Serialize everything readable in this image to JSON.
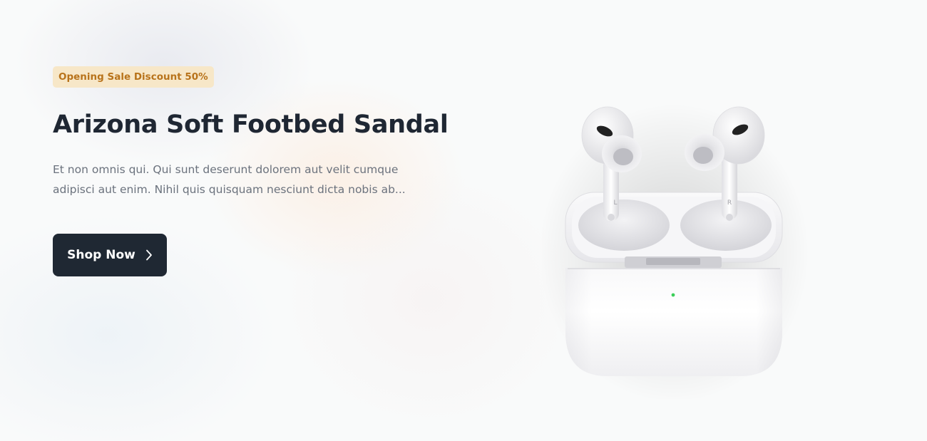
{
  "hero": {
    "badge": "Opening Sale Discount 50%",
    "title": "Arizona Soft Footbed Sandal",
    "description": "Et non omnis qui. Qui sunt deserunt dolorem aut velit cumque adipisci aut enim. Nihil quis quisquam nesciunt dicta nobis ab...",
    "button_label": "Shop Now",
    "button_icon": "chevron-right-icon"
  },
  "product_image": {
    "left_bud_mark": "L",
    "right_bud_mark": "R"
  },
  "colors": {
    "badge_bg": "#f7e7c8",
    "badge_text": "#b8731b",
    "title": "#1f2733",
    "button_bg": "#1f2833",
    "status_led": "#3ccf5a"
  }
}
